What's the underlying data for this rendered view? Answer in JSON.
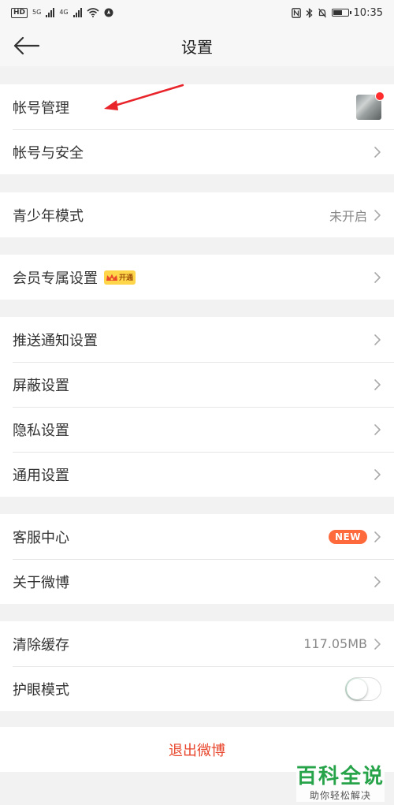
{
  "status_bar": {
    "left_chip": "HD",
    "net_5g": "5G",
    "net_4g": "4G",
    "time": "10:35"
  },
  "header": {
    "title": "设置"
  },
  "groups": [
    {
      "items": [
        {
          "label": "帐号管理",
          "right": "avatar",
          "avatar_has_red_dot": true
        },
        {
          "label": "帐号与安全",
          "right": "chevron"
        }
      ]
    },
    {
      "items": [
        {
          "label": "青少年模式",
          "value": "未开启",
          "right": "chevron"
        }
      ]
    },
    {
      "items": [
        {
          "label": "会员专属设置",
          "badge_text": "开通",
          "badge_icon": "crown-icon",
          "right": "chevron"
        }
      ]
    },
    {
      "items": [
        {
          "label": "推送通知设置",
          "right": "chevron"
        },
        {
          "label": "屏蔽设置",
          "right": "chevron"
        },
        {
          "label": "隐私设置",
          "right": "chevron"
        },
        {
          "label": "通用设置",
          "right": "chevron"
        }
      ]
    },
    {
      "items": [
        {
          "label": "客服中心",
          "badge": "NEW",
          "right": "chevron"
        },
        {
          "label": "关于微博",
          "right": "chevron"
        }
      ]
    },
    {
      "items": [
        {
          "label": "清除缓存",
          "value": "117.05MB",
          "right": "chevron"
        },
        {
          "label": "护眼模式",
          "right": "toggle",
          "toggle_on": false
        }
      ]
    },
    {
      "items": [
        {
          "label": "退出微博",
          "style": "danger"
        }
      ]
    }
  ],
  "watermark": {
    "main": "百科全说",
    "sub": "助你轻松解决"
  },
  "colors": {
    "accent_red": "#e8462c",
    "new_badge": "#ff6a3d",
    "notification_dot": "#ff2d2d",
    "watermark_green": "#27a34a",
    "annotation_arrow": "#e8232a"
  }
}
